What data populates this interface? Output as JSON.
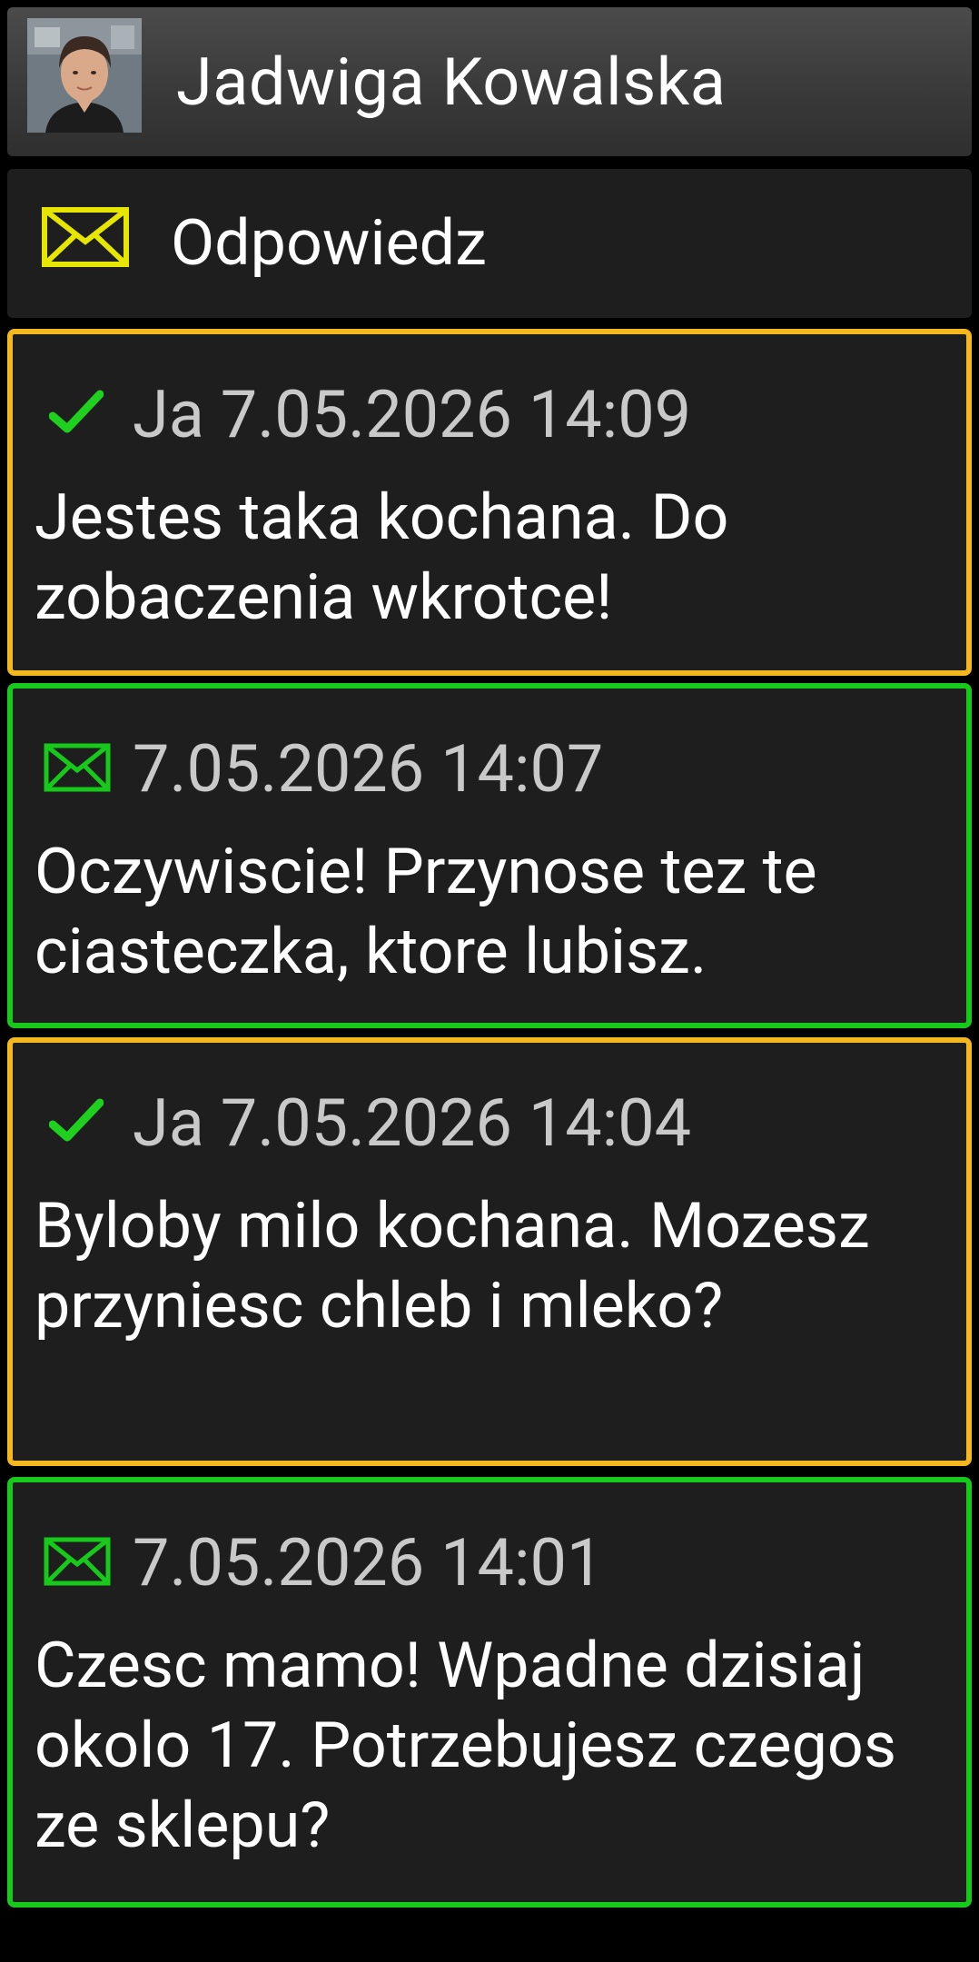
{
  "header": {
    "contact_name": "Jadwiga Kowalska"
  },
  "reply": {
    "label": "Odpowiedz"
  },
  "colors": {
    "sent_border": "#f4b71e",
    "received_border": "#17c91a",
    "reply_icon": "#e6e600",
    "check_icon": "#1fd01f"
  },
  "messages": [
    {
      "direction": "sent",
      "icon": "check-icon",
      "meta": "Ja 7.05.2026 14:09",
      "text": "Jestes taka kochana. Do zobaczenia wkrotce!"
    },
    {
      "direction": "received",
      "icon": "envelope-icon",
      "meta": "7.05.2026 14:07",
      "text": "Oczywiscie! Przynose tez te ciasteczka, ktore lubisz."
    },
    {
      "direction": "sent",
      "icon": "check-icon",
      "meta": "Ja 7.05.2026 14:04",
      "text": "Byloby milo kochana. Mozesz przyniesc chleb i mleko?"
    },
    {
      "direction": "received",
      "icon": "envelope-icon",
      "meta": "7.05.2026 14:01",
      "text": "Czesc mamo! Wpadne dzisiaj okolo 17. Potrzebujesz czegos ze sklepu?"
    }
  ]
}
